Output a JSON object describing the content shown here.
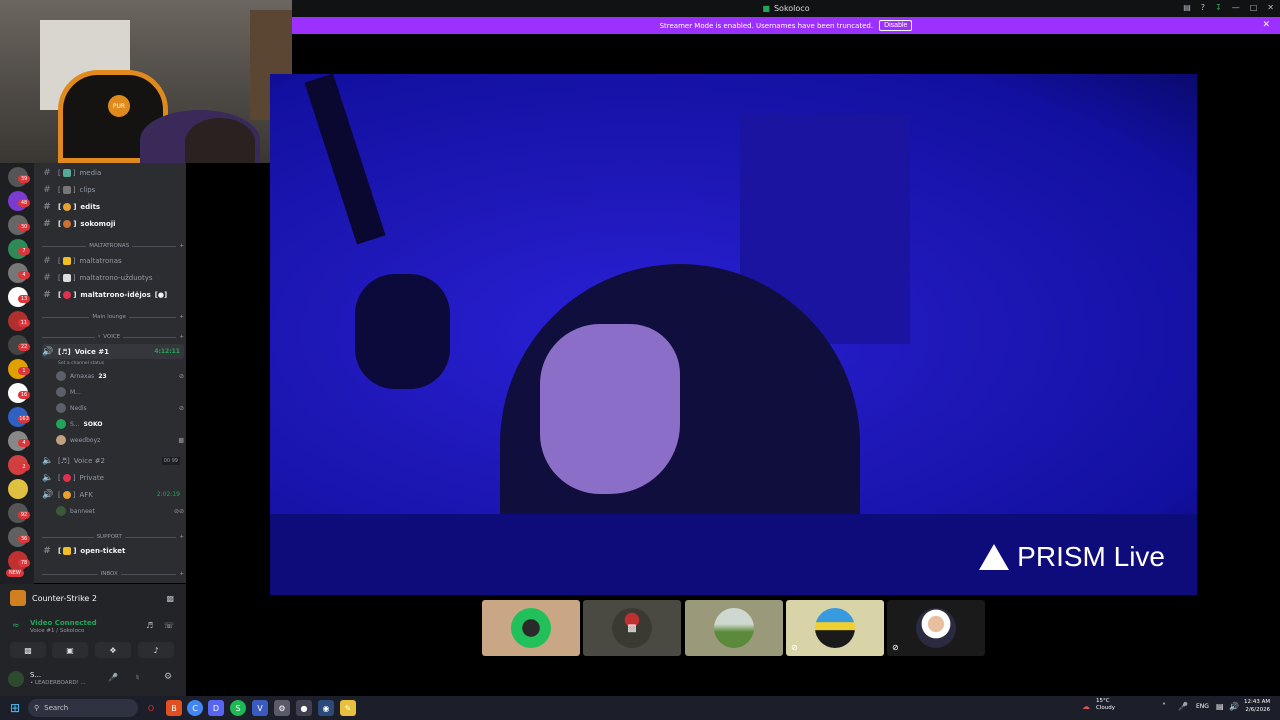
{
  "window": {
    "title": "Sokoloco",
    "icon": "game-icon"
  },
  "banner": {
    "text": "Streamer Mode is enabled. Usernames have been truncated.",
    "disable_label": "Disable",
    "color": "#9b30ff"
  },
  "servers": {
    "badges": [
      "39",
      "48",
      "30",
      "7",
      "4",
      "13",
      "11",
      "22",
      "",
      "1",
      "16",
      "163",
      "4",
      "2",
      "",
      "92",
      "36",
      "78",
      "44",
      "20"
    ],
    "new_label": "NEW"
  },
  "channels": {
    "text": [
      {
        "name": "media",
        "bold": false
      },
      {
        "name": "clips",
        "bold": false
      },
      {
        "name": "edits",
        "bold": true
      },
      {
        "name": "sokomoji",
        "bold": true
      },
      {
        "name": "maltatronas",
        "bold": false
      },
      {
        "name": "maltatrono-užduotys",
        "bold": false
      },
      {
        "name": "maltatrono-idėjos",
        "bold": true
      }
    ],
    "categories": {
      "maltatronas": "MALTATRONAS",
      "main_lounge": "Main lounge",
      "voice": "VOICE",
      "support": "SUPPORT",
      "inbox": "INBOX"
    },
    "voice1": {
      "name": "Voice #1",
      "timer": "4:12:11",
      "status_hint": "Set a channel status"
    },
    "voice_users": [
      {
        "name": "Arnaxas",
        "tag": "23"
      },
      {
        "name": "M...",
        "tag": ""
      },
      {
        "name": "Nedls",
        "tag": ""
      },
      {
        "name": "S...",
        "tag": "SOKO"
      },
      {
        "name": "weedboyz",
        "tag": ""
      }
    ],
    "voice2": {
      "name": "Voice #2",
      "count": "00",
      "limit": "99"
    },
    "private": "Private",
    "afk": {
      "name": "AFK",
      "timer": "2:02:19"
    },
    "afk_user": "banneet",
    "ticket": "open-ticket"
  },
  "activity": {
    "game": "Counter-Strike 2"
  },
  "voice_status": {
    "label": "Video Connected",
    "sub": "Voice #1 / Sokoloco"
  },
  "user": {
    "name": "S...",
    "status": "• LEADERBOARD! ..."
  },
  "video": {
    "overlay_brand": "PRISM Live"
  },
  "taskbar": {
    "search_placeholder": "Search",
    "weather_temp": "15°C",
    "weather_desc": "Cloudy",
    "lang": "ENG",
    "time": "12:43 AM",
    "date": "2/6/2026"
  }
}
